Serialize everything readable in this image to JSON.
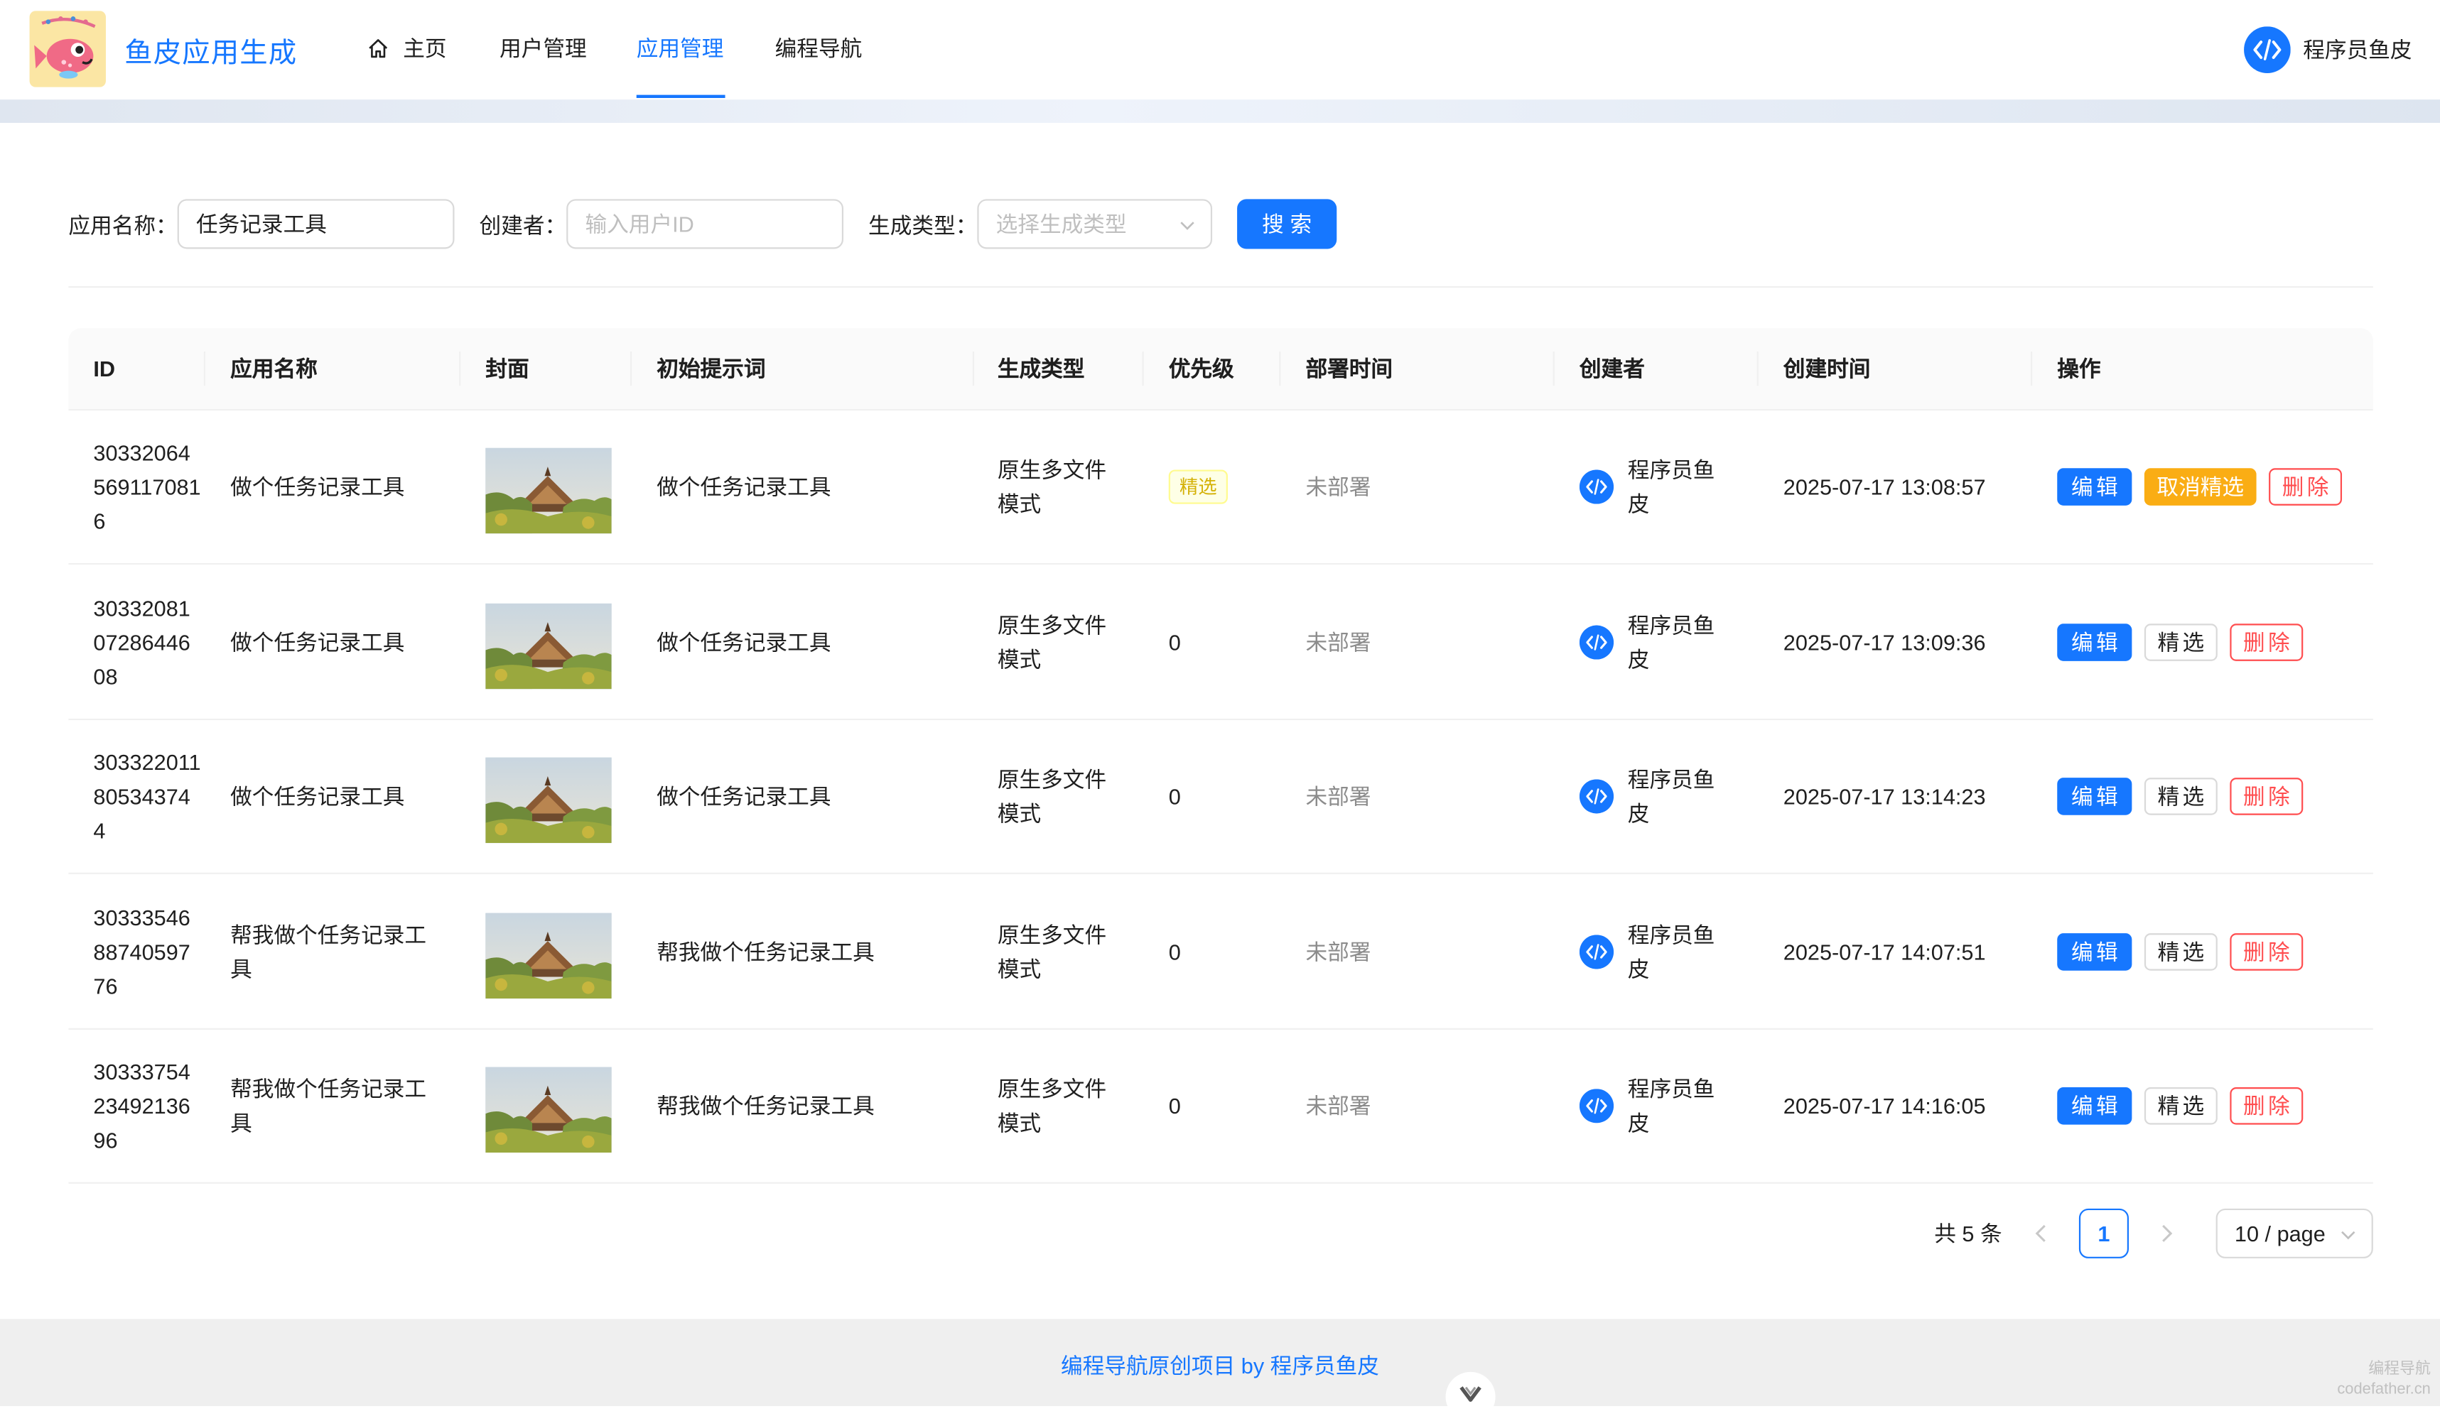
{
  "header": {
    "site_title": "鱼皮应用生成",
    "nav": [
      {
        "label": "主页",
        "active": false
      },
      {
        "label": "用户管理",
        "active": false
      },
      {
        "label": "应用管理",
        "active": true
      },
      {
        "label": "编程导航",
        "active": false
      }
    ],
    "user_name": "程序员鱼皮"
  },
  "search": {
    "app_name_label": "应用名称：",
    "app_name_value": "任务记录工具",
    "creator_label": "创建者：",
    "creator_placeholder": "输入用户ID",
    "gen_type_label": "生成类型：",
    "gen_type_placeholder": "选择生成类型",
    "search_button": "搜索"
  },
  "table": {
    "columns": [
      "ID",
      "应用名称",
      "封面",
      "初始提示词",
      "生成类型",
      "优先级",
      "部署时间",
      "创建者",
      "创建时间",
      "操作"
    ],
    "rows": [
      {
        "id": "303320645691170816",
        "name": "做个任务记录工具",
        "prompt": "做个任务记录工具",
        "type": "原生多文件模式",
        "priority": "精选",
        "featured": true,
        "deploy": "未部署",
        "creator": "程序员鱼皮",
        "created": "2025-07-17 13:08:57",
        "feature_action": "取消精选"
      },
      {
        "id": "303320810728644608",
        "name": "做个任务记录工具",
        "prompt": "做个任务记录工具",
        "type": "原生多文件模式",
        "priority": "0",
        "featured": false,
        "deploy": "未部署",
        "creator": "程序员鱼皮",
        "created": "2025-07-17 13:09:36",
        "feature_action": "精选"
      },
      {
        "id": "303322011805343744",
        "name": "做个任务记录工具",
        "prompt": "做个任务记录工具",
        "type": "原生多文件模式",
        "priority": "0",
        "featured": false,
        "deploy": "未部署",
        "creator": "程序员鱼皮",
        "created": "2025-07-17 13:14:23",
        "feature_action": "精选"
      },
      {
        "id": "303335468874059776",
        "name": "帮我做个任务记录工具",
        "prompt": "帮我做个任务记录工具",
        "type": "原生多文件模式",
        "priority": "0",
        "featured": false,
        "deploy": "未部署",
        "creator": "程序员鱼皮",
        "created": "2025-07-17 14:07:51",
        "feature_action": "精选"
      },
      {
        "id": "303337542349213696",
        "name": "帮我做个任务记录工具",
        "prompt": "帮我做个任务记录工具",
        "type": "原生多文件模式",
        "priority": "0",
        "featured": false,
        "deploy": "未部署",
        "creator": "程序员鱼皮",
        "created": "2025-07-17 14:16:05",
        "feature_action": "精选"
      }
    ],
    "edit_label": "编辑",
    "delete_label": "删除"
  },
  "pagination": {
    "total_text": "共 5 条",
    "current_page": "1",
    "page_size": "10 / page"
  },
  "footer": {
    "text": "编程导航原创项目 by 程序员鱼皮"
  },
  "watermark": {
    "line1": "编程导航",
    "line2": "codefather.cn"
  },
  "icons": {
    "home": "home-icon",
    "avatar": "code-logo-avatar",
    "cover": "cover-image-tower"
  },
  "colors": {
    "primary": "#1677ff",
    "warning": "#faad14",
    "danger": "#ff4d4f"
  }
}
